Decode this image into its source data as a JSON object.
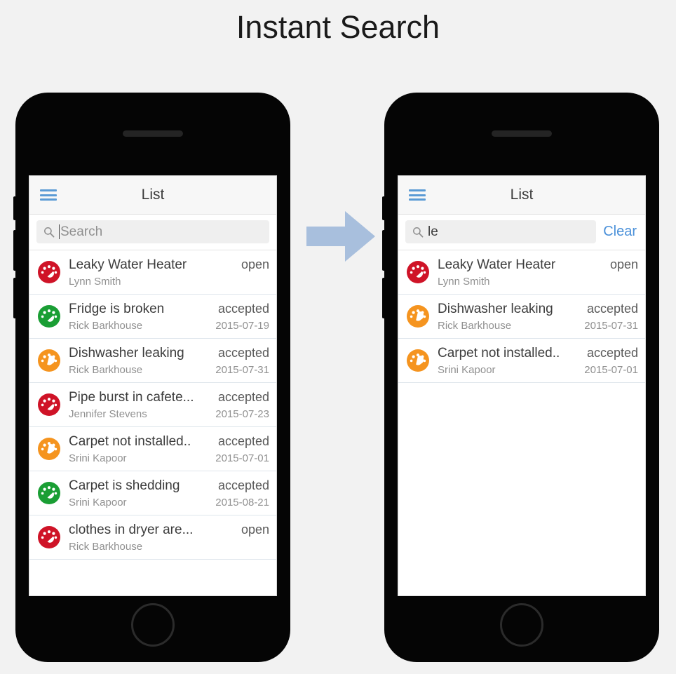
{
  "page": {
    "title": "Instant Search",
    "background_color": "#f2f2f2",
    "arrow_color": "#a8bfdd",
    "accent_color": "#5b9bd5",
    "link_color": "#4a90d9"
  },
  "icons": {
    "hamburger": "hamburger-menu-icon",
    "search": "search-icon",
    "arrow": "right-arrow-icon",
    "badge": "gauge-status-icon"
  },
  "phones": [
    {
      "id": "before",
      "appbar": {
        "menu_icon": "hamburger-menu-icon",
        "title": "List"
      },
      "search": {
        "value": "",
        "placeholder": "Search",
        "has_caret": true,
        "clear_label": null
      },
      "rows": [
        {
          "title": "Leaky Water Heater",
          "status": "open",
          "person": "Lynn Smith",
          "date": "",
          "badge_color": "#cf1327"
        },
        {
          "title": "Fridge is broken",
          "status": "accepted",
          "person": "Rick Barkhouse",
          "date": "2015-07-19",
          "badge_color": "#1a9e34"
        },
        {
          "title": "Dishwasher leaking",
          "status": "accepted",
          "person": "Rick Barkhouse",
          "date": "2015-07-31",
          "badge_color": "#f5941f"
        },
        {
          "title": "Pipe burst in cafete...",
          "status": "accepted",
          "person": "Jennifer Stevens",
          "date": "2015-07-23",
          "badge_color": "#cf1327"
        },
        {
          "title": "Carpet not installed..",
          "status": "accepted",
          "person": "Srini Kapoor",
          "date": "2015-07-01",
          "badge_color": "#f5941f"
        },
        {
          "title": "Carpet is shedding",
          "status": "accepted",
          "person": "Srini Kapoor",
          "date": "2015-08-21",
          "badge_color": "#1a9e34"
        },
        {
          "title": "clothes in dryer are...",
          "status": "open",
          "person": "Rick Barkhouse",
          "date": "",
          "badge_color": "#cf1327"
        }
      ]
    },
    {
      "id": "after",
      "appbar": {
        "menu_icon": "hamburger-menu-icon",
        "title": "List"
      },
      "search": {
        "value": "le",
        "placeholder": "Search",
        "has_caret": false,
        "clear_label": "Clear"
      },
      "rows": [
        {
          "title": "Leaky Water Heater",
          "status": "open",
          "person": "Lynn Smith",
          "date": "",
          "badge_color": "#cf1327"
        },
        {
          "title": "Dishwasher leaking",
          "status": "accepted",
          "person": "Rick Barkhouse",
          "date": "2015-07-31",
          "badge_color": "#f5941f"
        },
        {
          "title": "Carpet not installed..",
          "status": "accepted",
          "person": "Srini Kapoor",
          "date": "2015-07-01",
          "badge_color": "#f5941f"
        }
      ]
    }
  ]
}
